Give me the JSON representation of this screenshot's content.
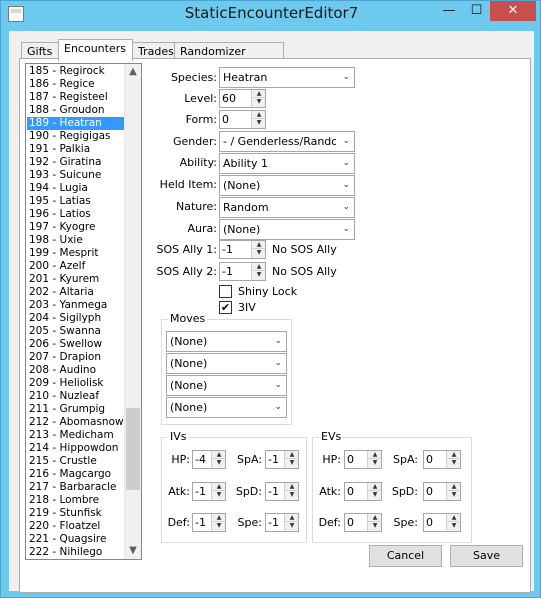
{
  "window": {
    "title": "StaticEncounterEditor7",
    "minimize": "—",
    "maximize": "☐",
    "close": "✕"
  },
  "tabs": [
    "Gifts",
    "Encounters",
    "Trades",
    "Randomizer Options"
  ],
  "list": {
    "items": [
      "185 - Regirock",
      "186 - Regice",
      "187 - Registeel",
      "188 - Groudon",
      "189 - Heatran",
      "190 - Regigigas",
      "191 - Palkia",
      "192 - Giratina",
      "193 - Suicune",
      "194 - Lugia",
      "195 - Latias",
      "196 - Latios",
      "197 - Kyogre",
      "198 - Uxie",
      "199 - Mesprit",
      "200 - Azelf",
      "201 - Kyurem",
      "202 - Altaria",
      "203 - Yanmega",
      "204 - Sigilyph",
      "205 - Swanna",
      "206 - Swellow",
      "207 - Drapion",
      "208 - Audino",
      "209 - Heliolisk",
      "210 - Nuzleaf",
      "211 - Grumpig",
      "212 - Abomasnow",
      "213 - Medicham",
      "214 - Hippowdon",
      "215 - Crustle",
      "216 - Magcargo",
      "217 - Barbaracle",
      "218 - Lombre",
      "219 - Stunfisk",
      "220 - Floatzel",
      "221 - Quagsire",
      "222 - Nihilego"
    ],
    "selected_index": 4,
    "scroll_up": "▲",
    "scroll_down": "▼"
  },
  "form": {
    "species_label": "Species:",
    "species_value": "Heatran",
    "level_label": "Level:",
    "level_value": "60",
    "form_label": "Form:",
    "form_value": "0",
    "gender_label": "Gender:",
    "gender_value": "- / Genderless/Random",
    "ability_label": "Ability:",
    "ability_value": "Ability 1",
    "held_item_label": "Held Item:",
    "held_item_value": "(None)",
    "nature_label": "Nature:",
    "nature_value": "Random",
    "aura_label": "Aura:",
    "aura_value": "(None)",
    "sos1_label": "SOS Ally 1:",
    "sos1_value": "-1",
    "sos1_status": "No SOS Ally",
    "sos2_label": "SOS Ally 2:",
    "sos2_value": "-1",
    "sos2_status": "No SOS Ally",
    "shiny_lock_label": "Shiny Lock",
    "shiny_lock_checked": false,
    "three_iv_label": "3IV",
    "three_iv_checked": true
  },
  "moves": {
    "title": "Moves",
    "values": [
      "(None)",
      "(None)",
      "(None)",
      "(None)"
    ]
  },
  "ivs": {
    "title": "IVs",
    "hp_label": "HP:",
    "hp": "-4",
    "atk_label": "Atk:",
    "atk": "-1",
    "def_label": "Def:",
    "def": "-1",
    "spa_label": "SpA:",
    "spa": "-1",
    "spd_label": "SpD:",
    "spd": "-1",
    "spe_label": "Spe:",
    "spe": "-1"
  },
  "evs": {
    "title": "EVs",
    "hp_label": "HP:",
    "hp": "0",
    "atk_label": "Atk:",
    "atk": "0",
    "def_label": "Def:",
    "def": "0",
    "spa_label": "SpA:",
    "spa": "0",
    "spd_label": "SpD:",
    "spd": "0",
    "spe_label": "Spe:",
    "spe": "0"
  },
  "buttons": {
    "cancel": "Cancel",
    "save": "Save"
  },
  "glyphs": {
    "dropdown": "⌄",
    "spin_up": "▲",
    "spin_down": "▼",
    "check": "✔"
  },
  "colors": {
    "selection": "#3399ff",
    "titlebar": "#6ec9ef",
    "close": "#c7504c"
  }
}
